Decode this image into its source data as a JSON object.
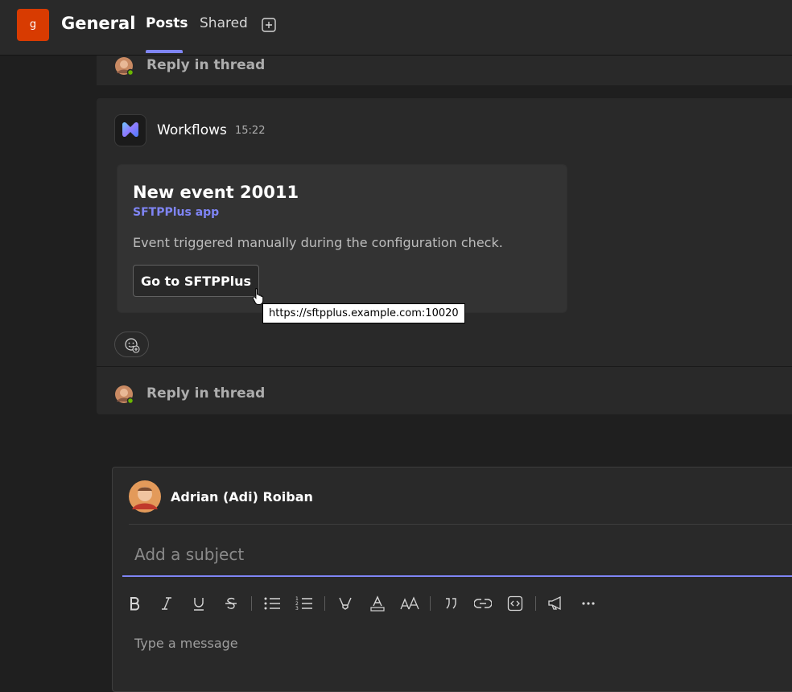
{
  "header": {
    "team_initial": "g",
    "channel_name": "General",
    "tabs": [
      {
        "label": "Posts",
        "active": true
      },
      {
        "label": "Shared",
        "active": false
      }
    ],
    "add_tab_icon": "plus-square-icon"
  },
  "thread_top": {
    "reply_label": "Reply in thread"
  },
  "post": {
    "author": "Workflows",
    "time": "15:22",
    "card": {
      "title": "New event 20011",
      "subtitle": "SFTPPlus app",
      "body": "Event triggered manually during the configuration check.",
      "button_label": "Go to SFTPPlus",
      "tooltip": "https://sftpplus.example.com:10020"
    },
    "reaction_icon": "add-reaction-icon",
    "reply_label": "Reply in thread"
  },
  "compose": {
    "author": "Adrian (Adi) Roiban",
    "subject_placeholder": "Add a subject",
    "message_placeholder": "Type a message",
    "toolbar": [
      "bold-icon",
      "italic-icon",
      "underline-icon",
      "strikethrough-icon",
      "bulleted-list-icon",
      "numbered-list-icon",
      "highlight-icon",
      "font-color-icon",
      "font-size-icon",
      "quote-icon",
      "link-icon",
      "code-snippet-icon",
      "announcement-icon",
      "more-options-icon"
    ]
  },
  "colors": {
    "accent": "#7f85f5",
    "team_badge": "#d83b01",
    "background": "#1f1f1f",
    "card": "#292929"
  }
}
